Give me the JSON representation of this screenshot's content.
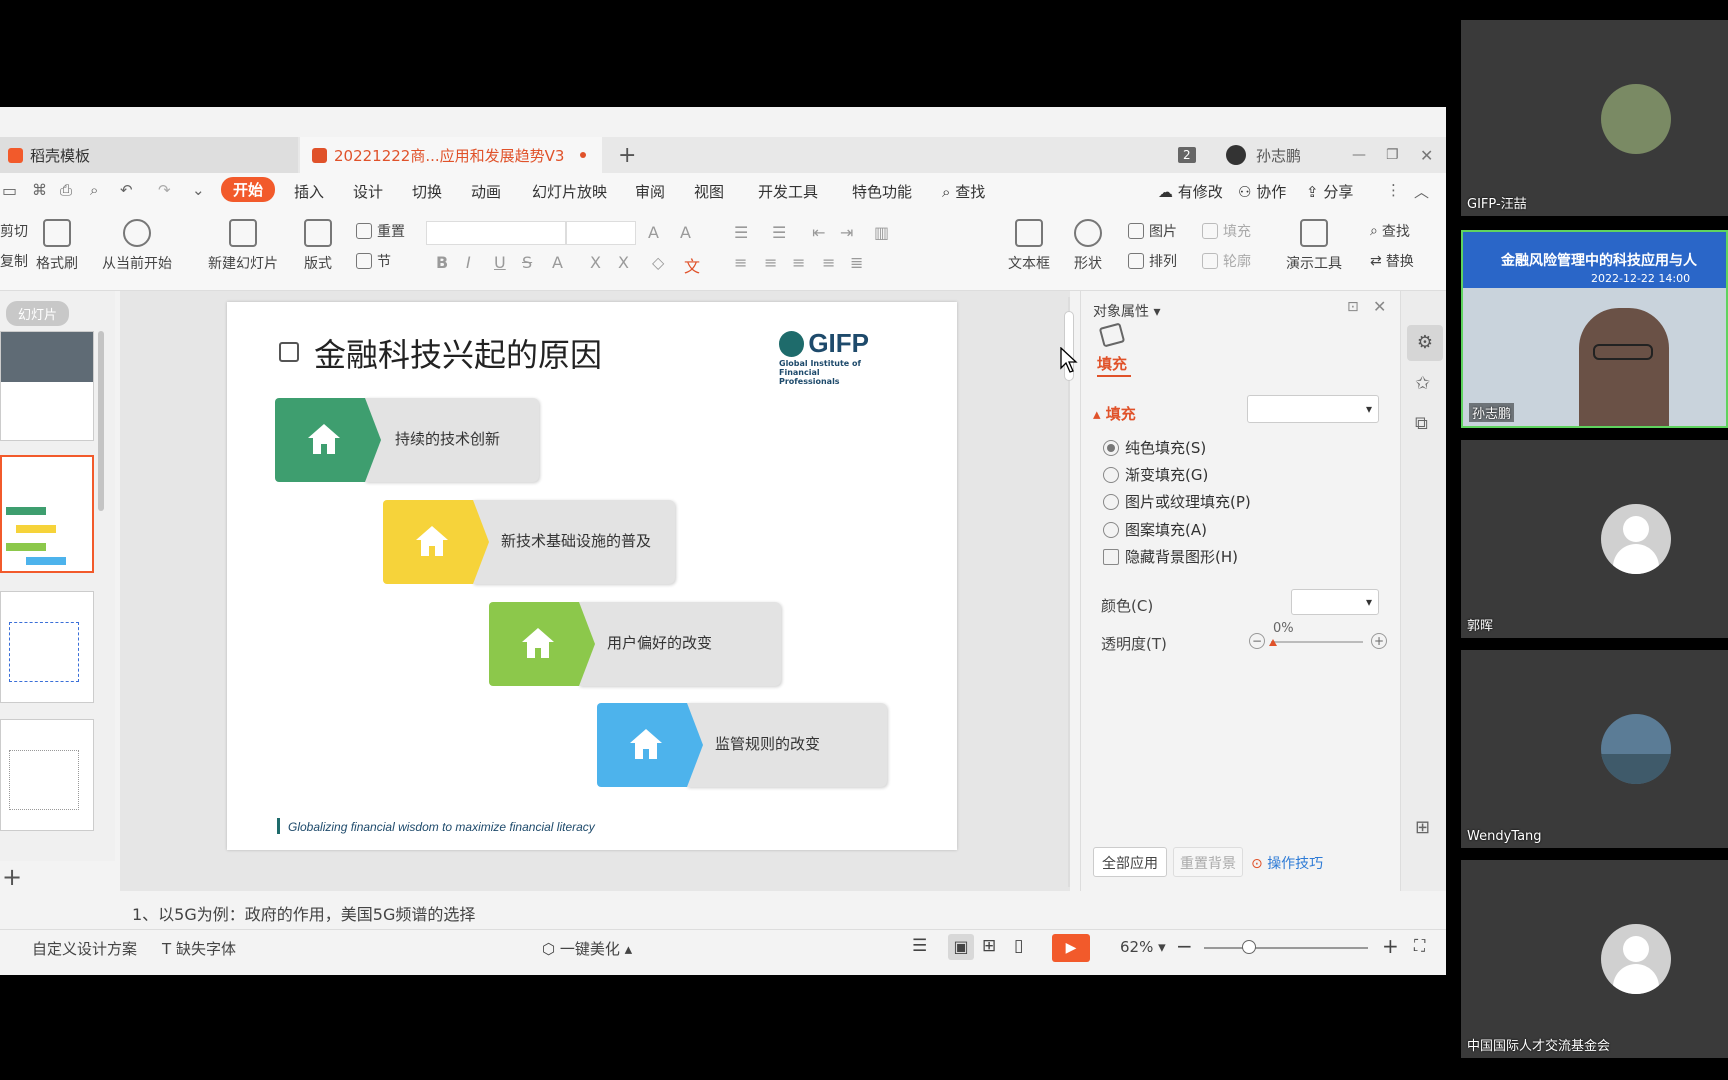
{
  "app": {
    "tabs": [
      {
        "label": "稻壳模板"
      },
      {
        "label": "20221222商...应用和发展趋势V3"
      }
    ],
    "new_tab": "+",
    "window_badge": "2",
    "user_name": "孙志鹏",
    "menu": [
      "开始",
      "插入",
      "设计",
      "切换",
      "动画",
      "幻灯片放映",
      "审阅",
      "视图",
      "开发工具",
      "特色功能"
    ],
    "menu_active": "开始",
    "search_label": "查找",
    "top_right_actions": [
      "有修改",
      "协作",
      "分享"
    ],
    "ribbon": {
      "cut": "剪切",
      "copy": "复制",
      "format_painter": "格式刷",
      "play_from_current": "从当前开始",
      "new_slide": "新建幻灯片",
      "layout": "版式",
      "reset": "重置",
      "section": "节",
      "text_box": "文本框",
      "shapes": "形状",
      "picture": "图片",
      "fill": "填充",
      "arrange": "排列",
      "outline": "轮廓",
      "presentation_tools": "演示工具",
      "find": "查找",
      "replace": "替换"
    },
    "thumbnails_label": "幻灯片",
    "add_slide": "+"
  },
  "slide": {
    "title": "金融科技兴起的原因",
    "logo_text": "GIFP",
    "logo_sub1": "Global Institute of",
    "logo_sub2": "Financial Professionals",
    "steps": [
      {
        "label": "持续的技术创新",
        "color": "#3e9e6f"
      },
      {
        "label": "新技术基础设施的普及",
        "color": "#f6d33a"
      },
      {
        "label": "用户偏好的改变",
        "color": "#8cc84b"
      },
      {
        "label": "监管规则的改变",
        "color": "#4db3ec"
      }
    ],
    "footer": "Globalizing financial wisdom to maximize financial literacy"
  },
  "properties": {
    "title": "对象属性",
    "tab_fill": "填充",
    "section_fill": "填充",
    "options": [
      "纯色填充(S)",
      "渐变填充(G)",
      "图片或纹理填充(P)",
      "图案填充(A)"
    ],
    "selected_option": 0,
    "hide_bg": "隐藏背景图形(H)",
    "color_label": "颜色(C)",
    "transparency_label": "透明度(T)",
    "transparency_value": "0%",
    "apply_all": "全部应用",
    "reset_bg": "重置背景",
    "tips": "操作技巧"
  },
  "notes": "1、以5G为例：政府的作用，美国5G频谱的选择",
  "status": {
    "custom_design": "自定义设计方案",
    "missing_font": "缺失字体",
    "beautify": "一键美化",
    "zoom": "62%"
  },
  "participants": [
    {
      "name": "GIFP-汪喆"
    },
    {
      "name": "孙志鹏",
      "banner_title": "金融风险管理中的科技应用与人",
      "banner_date": "2022-12-22  14:00"
    },
    {
      "name": "郭晖"
    },
    {
      "name": "WendyTang"
    },
    {
      "name": "中国国际人才交流基金会"
    }
  ],
  "colors": {
    "accent": "#f25a2b",
    "link": "#2e7bd6"
  }
}
